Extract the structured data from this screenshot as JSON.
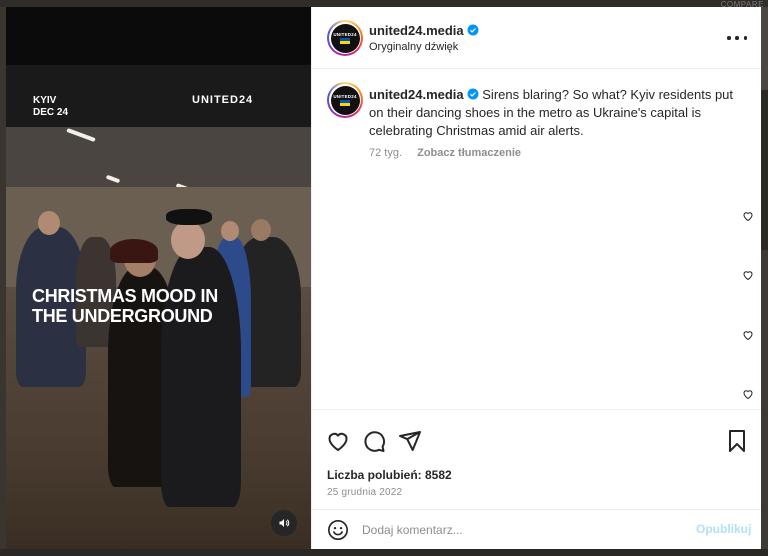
{
  "backdrop": {
    "corner_text": "COMPARE"
  },
  "video": {
    "location": "KYIV",
    "date": "DEC 24",
    "brand": "UNITED24",
    "caption": "CHRISTMAS MOOD IN THE UNDERGROUND",
    "sound_icon": "speaker-icon"
  },
  "post": {
    "username": "united24.media",
    "audio": "Oryginalny dźwięk",
    "avatar_text": "UNITED24",
    "caption_username": "united24.media",
    "caption": "Sirens blaring? So what? Kyiv residents put on their dancing shoes in the metro as Ukraine's capital is celebrating Christmas amid air alerts.",
    "age": "72 tyg.",
    "translate": "Zobacz tłumaczenie",
    "likes": "Liczba polubień: 8582",
    "date": "25 grudnia 2022",
    "comment_placeholder": "Dodaj komentarz...",
    "post_button": "Opublikuj"
  },
  "colors": {
    "accent_verified": "#0095f6",
    "post_button_disabled": "#b2dffc",
    "text_primary": "#262626",
    "text_secondary": "#8e8e8e"
  }
}
